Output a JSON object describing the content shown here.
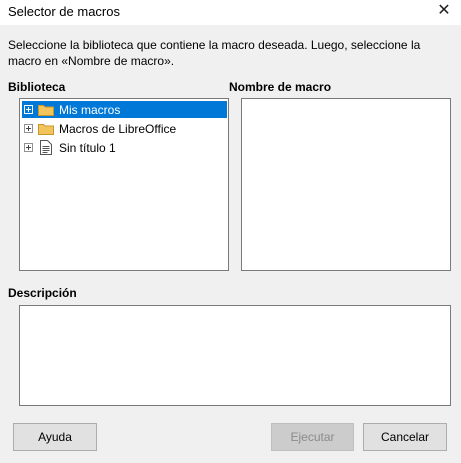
{
  "window": {
    "title": "Selector de macros"
  },
  "instructions": "Seleccione la biblioteca que contiene la macro deseada. Luego, seleccione la macro en «Nombre de macro».",
  "library": {
    "label": "Biblioteca",
    "items": [
      {
        "label": "Mis macros",
        "icon": "folder-icon",
        "selected": true
      },
      {
        "label": "Macros de LibreOffice",
        "icon": "folder-icon",
        "selected": false
      },
      {
        "label": "Sin título 1",
        "icon": "document-icon",
        "selected": false
      }
    ]
  },
  "macro_name": {
    "label": "Nombre de macro"
  },
  "description": {
    "label": "Descripción"
  },
  "buttons": {
    "help": "Ayuda",
    "run": "Ejecutar",
    "cancel": "Cancelar"
  },
  "colors": {
    "selection": "#0078d7",
    "folder": "#f2c55c"
  }
}
